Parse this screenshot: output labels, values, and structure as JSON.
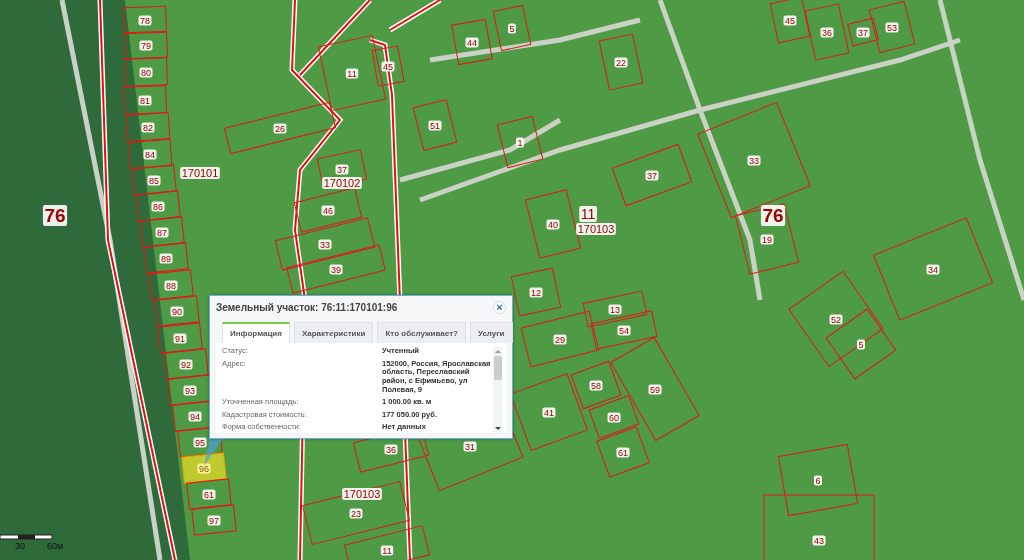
{
  "map": {
    "district_labels": [
      {
        "text": "76"
      },
      {
        "text": "76"
      }
    ],
    "area_labels": [
      {
        "text": "11"
      }
    ],
    "block_labels": [
      {
        "text": "170101"
      },
      {
        "text": "170102"
      },
      {
        "text": "170103"
      },
      {
        "text": "170103"
      }
    ],
    "parcels": [
      {
        "number": "78",
        "selected": false
      },
      {
        "number": "79",
        "selected": false
      },
      {
        "number": "80",
        "selected": false
      },
      {
        "number": "81",
        "selected": false
      },
      {
        "number": "82",
        "selected": false
      },
      {
        "number": "84",
        "selected": false
      },
      {
        "number": "85",
        "selected": false
      },
      {
        "number": "86",
        "selected": false
      },
      {
        "number": "87",
        "selected": false
      },
      {
        "number": "89",
        "selected": false
      },
      {
        "number": "88",
        "selected": false
      },
      {
        "number": "90",
        "selected": false
      },
      {
        "number": "91",
        "selected": false
      },
      {
        "number": "92",
        "selected": false
      },
      {
        "number": "93",
        "selected": false
      },
      {
        "number": "94",
        "selected": false
      },
      {
        "number": "95",
        "selected": false
      },
      {
        "number": "96",
        "selected": true
      },
      {
        "number": "61",
        "selected": false
      },
      {
        "number": "97",
        "selected": false
      },
      {
        "number": "26",
        "selected": false
      },
      {
        "number": "11",
        "selected": false
      },
      {
        "number": "45",
        "selected": false
      },
      {
        "number": "44",
        "selected": false
      },
      {
        "number": "51",
        "selected": false
      },
      {
        "number": "37",
        "selected": false
      },
      {
        "number": "46",
        "selected": false
      },
      {
        "number": "33",
        "selected": false
      },
      {
        "number": "39",
        "selected": false
      },
      {
        "number": "40",
        "selected": false
      },
      {
        "number": "37",
        "selected": false
      },
      {
        "number": "33",
        "selected": false
      },
      {
        "number": "19",
        "selected": false
      },
      {
        "number": "22",
        "selected": false
      },
      {
        "number": "1",
        "selected": false
      },
      {
        "number": "5",
        "selected": false
      },
      {
        "number": "45",
        "selected": false
      },
      {
        "number": "36",
        "selected": false
      },
      {
        "number": "37",
        "selected": false
      },
      {
        "number": "53",
        "selected": false
      },
      {
        "number": "34",
        "selected": false
      },
      {
        "number": "12",
        "selected": false
      },
      {
        "number": "13",
        "selected": false
      },
      {
        "number": "54",
        "selected": false
      },
      {
        "number": "29",
        "selected": false
      },
      {
        "number": "58",
        "selected": false
      },
      {
        "number": "59",
        "selected": false
      },
      {
        "number": "41",
        "selected": false
      },
      {
        "number": "60",
        "selected": false
      },
      {
        "number": "61",
        "selected": false
      },
      {
        "number": "52",
        "selected": false
      },
      {
        "number": "5",
        "selected": false
      },
      {
        "number": "6",
        "selected": false
      },
      {
        "number": "43",
        "selected": false
      },
      {
        "number": "36",
        "selected": false
      },
      {
        "number": "31",
        "selected": false
      },
      {
        "number": "23",
        "selected": false
      },
      {
        "number": "11",
        "selected": false
      }
    ]
  },
  "scale_bar": {
    "labels": [
      "30",
      "60м"
    ]
  },
  "popup": {
    "title": "Земельный участок: 76:11:170101:96",
    "close": "×",
    "tabs": [
      {
        "label": "Информация",
        "selected": true
      },
      {
        "label": "Характеристики",
        "selected": false
      },
      {
        "label": "Кто обслуживает?",
        "selected": false
      },
      {
        "label": "Услуги",
        "selected": false
      }
    ],
    "rows": [
      {
        "label": "Статус:",
        "value": "Учтенный"
      },
      {
        "label": "Адрес:",
        "value": "152000, Россия, Ярославская область, Переславский район, с Ефимьево, ул Полевая, 9"
      },
      {
        "label": "Уточненная площадь:",
        "value": "1 000.00 кв. м"
      },
      {
        "label": "Кадастровая стоимость:",
        "value": "177 050.00 руб."
      },
      {
        "label": "Форма собственности:",
        "value": "Нет данных"
      }
    ]
  }
}
